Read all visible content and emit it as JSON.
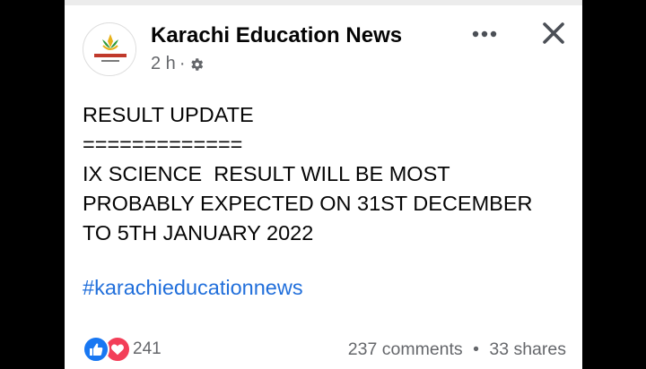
{
  "post": {
    "page_name": "Karachi Education News",
    "time": "2 h",
    "separator": "·",
    "privacy_icon": "gear-icon",
    "lines": [
      "RESULT UPDATE",
      "=============",
      "IX SCIENCE  RESULT WILL BE MOST",
      "PROBABLY EXPECTED ON 31ST DECEMBER",
      "TO 5TH JANUARY 2022"
    ],
    "hashtag": "#karachieducationnews"
  },
  "header": {
    "more_icon": "more-horizontal-icon",
    "close_icon": "close-icon"
  },
  "footer": {
    "reaction_icons": [
      "like-icon",
      "love-icon"
    ],
    "reaction_count": "241",
    "comments": "237 comments",
    "stats_separator": "•",
    "shares": "33 shares"
  },
  "colors": {
    "link": "#216fdb",
    "like": "#1877f2",
    "love": "#f33e58",
    "secondary_text": "#65676b"
  }
}
